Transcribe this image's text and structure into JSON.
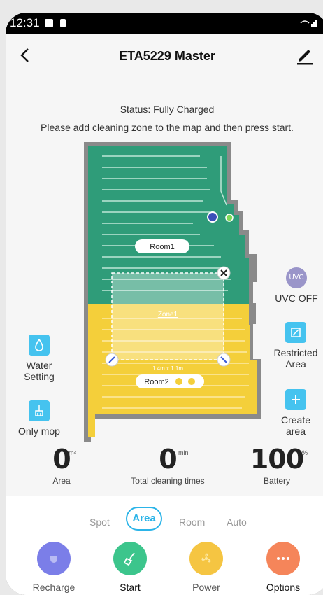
{
  "status_bar": {
    "time": "12:31"
  },
  "header": {
    "title": "ETA5229 Master"
  },
  "status": "Status: Fully Charged",
  "hint": "Please add cleaning zone to the map and then press start.",
  "map": {
    "room1_label": "Room1",
    "room2_label": "Room2",
    "zone_label": "Zone1",
    "zone_size": "1.4m x 1.1m"
  },
  "left_controls": [
    {
      "label_line1": "Water",
      "label_line2": "Setting"
    },
    {
      "label_line1": "Only mop"
    }
  ],
  "right_controls": {
    "uvc_label": "UVC OFF",
    "uvc_icon_text": "UVC",
    "restricted_line1": "Restricted",
    "restricted_line2": "Area",
    "create_line1": "Create",
    "create_line2": "area"
  },
  "stats": {
    "area": {
      "value": "0",
      "unit": "m²",
      "label": "Area"
    },
    "cleaning": {
      "value": "0",
      "unit": "min",
      "label": "Total cleaning times"
    },
    "battery": {
      "value": "100",
      "unit": "%",
      "label": "Battery"
    }
  },
  "modes": {
    "spot": "Spot",
    "area": "Area",
    "room": "Room",
    "auto": "Auto",
    "active": "Area"
  },
  "actions": {
    "recharge": "Recharge",
    "start": "Start",
    "power": "Power",
    "options": "Options"
  },
  "colors": {
    "room1": "#2f9c79",
    "room2": "#f4cf3a",
    "accent": "#2bb4e8",
    "recharge": "#7b7ee8",
    "start": "#3cc58c",
    "power": "#f5c542",
    "options": "#f5855a"
  }
}
